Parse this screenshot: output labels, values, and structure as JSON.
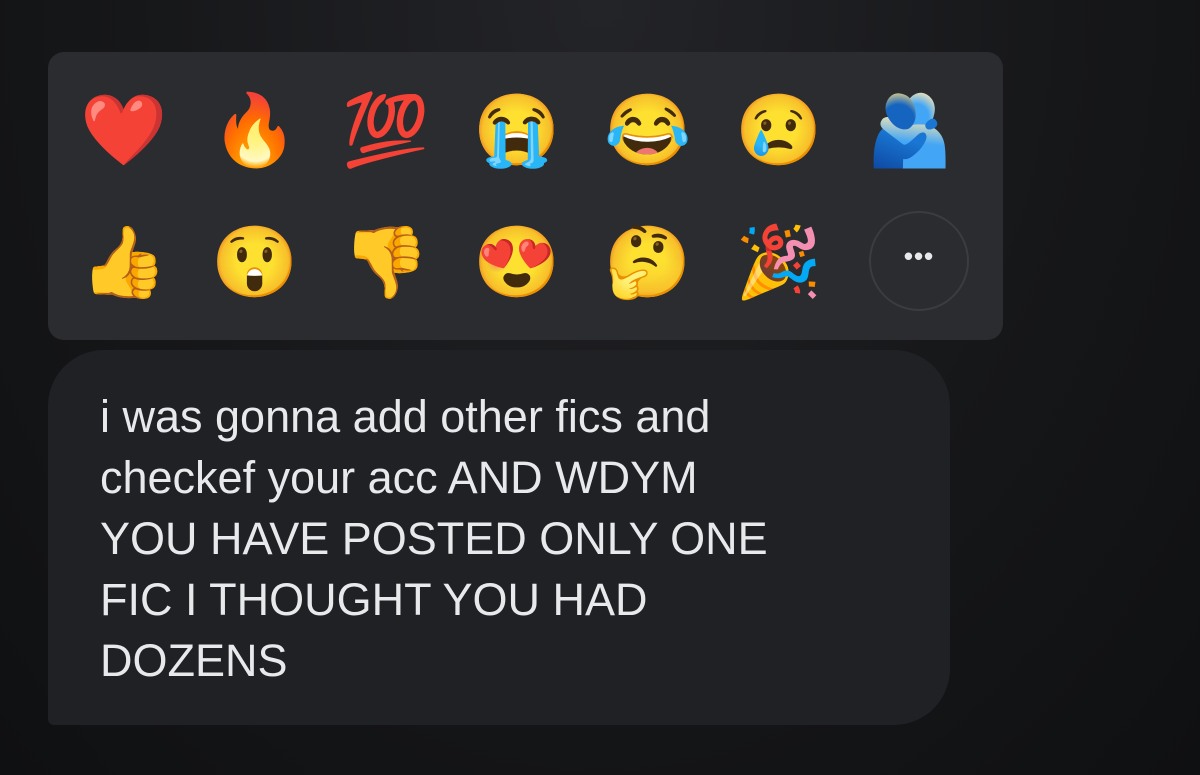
{
  "reactions": {
    "row1": [
      {
        "emoji": "❤️",
        "name": "red-heart"
      },
      {
        "emoji": "🔥",
        "name": "fire"
      },
      {
        "emoji": "💯",
        "name": "hundred-points"
      },
      {
        "emoji": "😭",
        "name": "loudly-crying-face"
      },
      {
        "emoji": "😂",
        "name": "face-with-tears-of-joy"
      },
      {
        "emoji": "😢",
        "name": "crying-face"
      },
      {
        "emoji": "🫂",
        "name": "people-hugging"
      }
    ],
    "row2": [
      {
        "emoji": "👍",
        "name": "thumbs-up"
      },
      {
        "emoji": "😲",
        "name": "astonished-face"
      },
      {
        "emoji": "👎",
        "name": "thumbs-down"
      },
      {
        "emoji": "😍",
        "name": "smiling-face-with-heart-eyes"
      },
      {
        "emoji": "🤔",
        "name": "thinking-face"
      },
      {
        "emoji": "🎉",
        "name": "party-popper"
      }
    ],
    "more_label": "•••"
  },
  "message": {
    "lines": [
      "i was gonna add other fics and",
      "checkef your acc AND WDYM",
      "YOU HAVE POSTED ONLY ONE",
      "FIC I THOUGHT YOU HAD",
      "DOZENS"
    ]
  }
}
